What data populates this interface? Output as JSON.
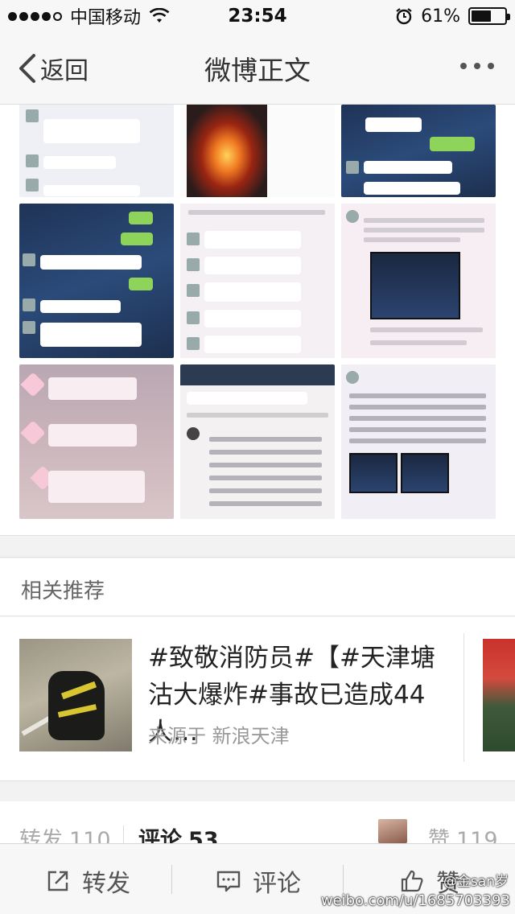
{
  "status_bar": {
    "carrier": "中国移动",
    "time": "23:54",
    "battery_percent": "61%",
    "battery_level": 0.61
  },
  "nav": {
    "back_label": "返回",
    "title": "微博正文"
  },
  "related": {
    "section_title": "相关推荐",
    "card": {
      "text": "#致敬消防员#【#天津塘沽大爆炸#事故已造成44人…",
      "source": "来源于 新浪天津"
    }
  },
  "stats": {
    "repost_label": "转发",
    "repost_count": "110",
    "comment_label": "评论",
    "comment_count": "53",
    "like_label": "赞",
    "like_count": "119"
  },
  "toolbar": {
    "repost_label": "转发",
    "comment_label": "评论",
    "like_label": "赞"
  },
  "watermark": {
    "handle": "@金san岁",
    "url": "weibo.com/u/1685703393"
  }
}
